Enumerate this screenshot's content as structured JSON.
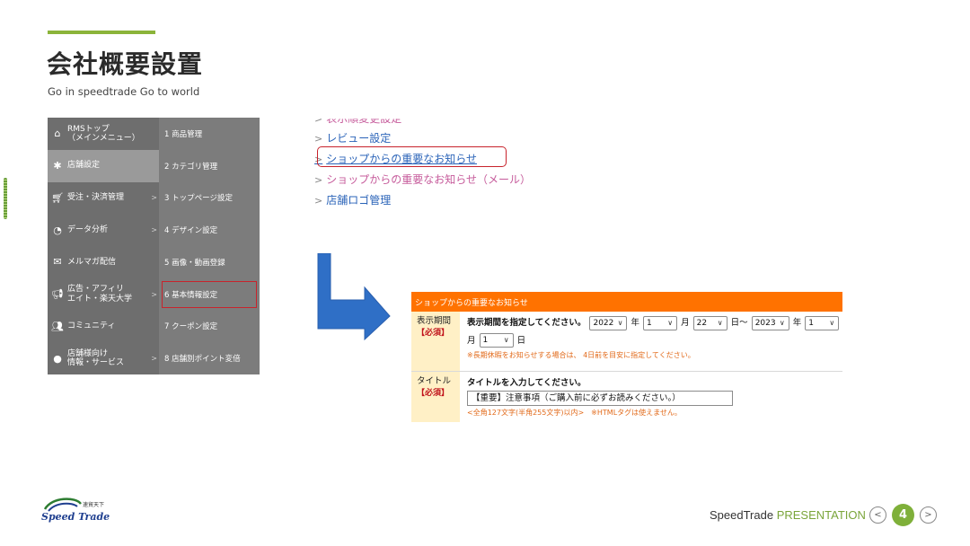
{
  "slide": {
    "title": "会社概要設置",
    "subtitle": "Go in speedtrade Go to world"
  },
  "rms_menu": {
    "items": [
      {
        "icon": "home-icon",
        "label": "RMSトップ\n（メインメニュー）",
        "sub": "1 商品管理",
        "active": false
      },
      {
        "icon": "gear-icon",
        "label": "店舗設定",
        "sub": "2 カテゴリ管理",
        "active": true
      },
      {
        "icon": "cart-icon",
        "label": "受注・決済管理",
        "sub": "3 トップページ設定",
        "active": false
      },
      {
        "icon": "pie-chart-icon",
        "label": "データ分析",
        "sub": "4 デザイン設定",
        "active": false
      },
      {
        "icon": "mail-icon",
        "label": "メルマガ配信",
        "sub": "5 画像・動画登録",
        "active": false
      },
      {
        "icon": "megaphone-icon",
        "label": "広告・アフィリ\nエイト・楽天大学",
        "sub": "6 基本情報設定",
        "active": false
      },
      {
        "icon": "people-icon",
        "label": "コミュニティ",
        "sub": "7 クーポン設定",
        "active": false
      },
      {
        "icon": "info-icon",
        "label": "店舗様向け\n情報・サービス",
        "sub": "8 店舗別ポイント変倍",
        "active": false
      }
    ]
  },
  "links": {
    "items": [
      {
        "label": "レビュー設定",
        "color": "blue"
      },
      {
        "label": "ショップからの重要なお知らせ",
        "color": "blue"
      },
      {
        "label": "ショップからの重要なお知らせ（メール）",
        "color": "pink"
      },
      {
        "label": "店舗ロゴ管理",
        "color": "blue"
      }
    ]
  },
  "form": {
    "header": "ショップからの重要なお知らせ",
    "period": {
      "label": "表示期間",
      "required": "【必須】",
      "instruction": "表示期間を指定してください。",
      "start_year": "2022",
      "year_unit": "年",
      "start_month": "1",
      "month_unit": "月",
      "start_day": "22",
      "day_unit_tilde": "日～",
      "end_year": "2023",
      "end_month": "1",
      "end_day": "1",
      "day_unit": "日",
      "note": "※長期休暇をお知らせする場合は、 4日前を目安に指定してください。"
    },
    "title_row": {
      "label": "タイトル",
      "required": "【必須】",
      "instruction": "タイトルを入力してください。",
      "value": "【重要】注意事項（ご購入前に必ずお読みください。）",
      "note": "<全角127文字(半角255文字)以内>　※HTMLタグは使えません。"
    }
  },
  "footer": {
    "logo_text": "Speed Trade",
    "logo_cn": "速貿天下",
    "brand": "SpeedTrade",
    "presentation": "PRESENTATION",
    "page": "4"
  },
  "colors": {
    "accent_green": "#8bb43a",
    "orange": "#ff7200",
    "highlight_red": "#c8232c",
    "link_blue": "#2a63b8",
    "link_pink": "#c65b9b",
    "arrow_blue": "#2f6fc6"
  }
}
